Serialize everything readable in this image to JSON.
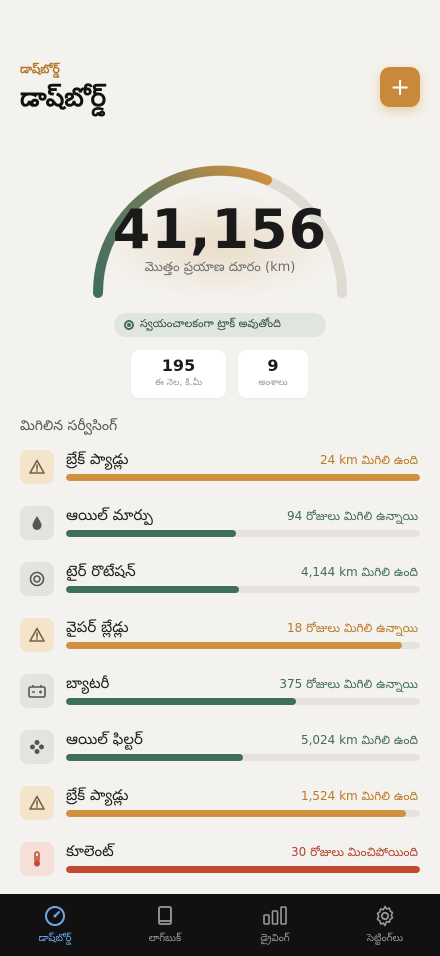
{
  "header": {
    "eyebrow": "డాష్‌బోర్డ్",
    "title": "డాష్‌బోర్డ్",
    "add_label": "+"
  },
  "odometer": {
    "value": "41,156",
    "label": "మొత్తం ప్రయాణ దూరం (km)",
    "status": "స్వయంచాలకంగా ట్రాక్ అవుతోంది"
  },
  "stats": [
    {
      "value": "195",
      "label": "ఈ నెల, కి.మీ"
    },
    {
      "value": "9",
      "label": "అంశాలు"
    }
  ],
  "section_title": "మిగిలిన సర్వీసింగ్",
  "colors": {
    "orange": "#d1913f",
    "green": "#3f6d5e",
    "red": "#c14a31",
    "track": "#e6e3de"
  },
  "services": [
    {
      "name": "బ్రేక్ ప్యాడ్లు",
      "status": "24 km మిగిలి ఉంది",
      "icon": "warning-icon",
      "color": "orange",
      "progress": 1.0
    },
    {
      "name": "ఆయిల్ మార్పు",
      "status": "94 రోజులు మిగిలి ఉన్నాయి",
      "icon": "oil-drop-icon",
      "color": "green",
      "progress": 0.48
    },
    {
      "name": "టైర్ రొటేషన్",
      "status": "4,144 km మిగిలి ఉంది",
      "icon": "tire-icon",
      "color": "green",
      "progress": 0.49
    },
    {
      "name": "వైపర్ బ్లేడ్లు",
      "status": "18 రోజులు మిగిలి ఉన్నాయి",
      "icon": "warning-icon",
      "color": "orange",
      "progress": 0.95
    },
    {
      "name": "బ్యాటరీ",
      "status": "375 రోజులు మిగిలి ఉన్నాయి",
      "icon": "battery-icon",
      "color": "green",
      "progress": 0.65
    },
    {
      "name": "ఆయిల్ ఫిల్టర్",
      "status": "5,024 km మిగిలి ఉంది",
      "icon": "filter-icon",
      "color": "green",
      "progress": 0.5
    },
    {
      "name": "బ్రేక్ ప్యాడ్లు",
      "status": "1,524 km మిగిలి ఉంది",
      "icon": "warning-icon",
      "color": "orange",
      "progress": 0.96
    },
    {
      "name": "కూలెంట్",
      "status": "30 రోజులు మించిపోయింది",
      "icon": "thermometer-icon",
      "color": "red",
      "progress": 1.0
    }
  ],
  "nav": [
    {
      "label": "డాష్‌బోర్డ్",
      "icon": "gauge-icon",
      "active": true
    },
    {
      "label": "లాగ్‌బుక్",
      "icon": "book-icon",
      "active": false
    },
    {
      "label": "డ్రైవింగ్",
      "icon": "bar-chart-icon",
      "active": false
    },
    {
      "label": "సెట్టింగ్‌లు",
      "icon": "gear-icon",
      "active": false
    }
  ]
}
